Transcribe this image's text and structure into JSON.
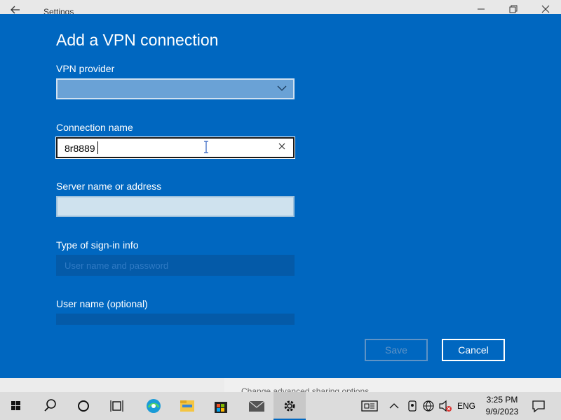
{
  "window": {
    "title": "Settings",
    "background_hint": "Change advanced sharing options"
  },
  "dialog": {
    "title": "Add a VPN connection",
    "vpn_provider": {
      "label": "VPN provider",
      "value": ""
    },
    "connection_name": {
      "label": "Connection name",
      "value": "8r8889"
    },
    "server": {
      "label": "Server name or address",
      "value": ""
    },
    "signin_type": {
      "label": "Type of sign-in info",
      "value": "User name and password"
    },
    "username": {
      "label": "User name (optional)",
      "value": ""
    },
    "save_label": "Save",
    "cancel_label": "Cancel",
    "accent_color": "#0067c0"
  },
  "taskbar": {
    "icons": [
      "windows-start-icon",
      "search-icon",
      "cortana-icon",
      "task-view-icon",
      "edge-icon",
      "file-explorer-icon",
      "store-icon",
      "mail-icon",
      "settings-icon"
    ],
    "language": "ENG",
    "time": "3:25 PM",
    "date": "9/9/2023"
  }
}
